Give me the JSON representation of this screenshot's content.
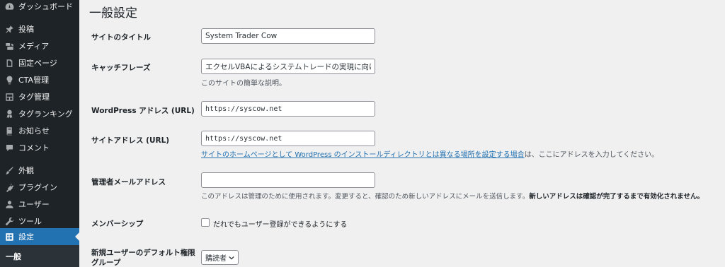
{
  "sidebar": {
    "items": [
      {
        "label": "ダッシュボード",
        "icon": "dashboard-icon"
      },
      {
        "label": "投稿",
        "icon": "pin-icon"
      },
      {
        "label": "メディア",
        "icon": "media-icon"
      },
      {
        "label": "固定ページ",
        "icon": "page-icon"
      },
      {
        "label": "CTA管理",
        "icon": "lightbulb-icon"
      },
      {
        "label": "タグ管理",
        "icon": "layout-icon"
      },
      {
        "label": "タグランキング",
        "icon": "award-icon"
      },
      {
        "label": "お知らせ",
        "icon": "book-icon"
      },
      {
        "label": "コメント",
        "icon": "comment-icon"
      },
      {
        "label": "外観",
        "icon": "brush-icon"
      },
      {
        "label": "プラグイン",
        "icon": "plugin-icon"
      },
      {
        "label": "ユーザー",
        "icon": "user-icon"
      },
      {
        "label": "ツール",
        "icon": "wrench-icon"
      },
      {
        "label": "設定",
        "icon": "settings-icon"
      }
    ],
    "submenu_active": "一般",
    "accent_color": "#2271b1"
  },
  "main": {
    "title": "一般設定",
    "fields": {
      "site_title": {
        "label": "サイトのタイトル",
        "value": "System Trader Cow"
      },
      "tagline": {
        "label": "キャッチフレーズ",
        "value": "エクセルVBAによるシステムトレードの実現に向けて",
        "description": "このサイトの簡単な説明。"
      },
      "wp_address": {
        "label": "WordPress アドレス (URL)",
        "value": "https://syscow.net"
      },
      "site_address": {
        "label": "サイトアドレス (URL)",
        "value": "https://syscow.net",
        "description_link": "サイトのホームページとして WordPress のインストールディレクトリとは異なる場所を設定する場合",
        "description_rest": "は、ここにアドレスを入力してください。"
      },
      "admin_email": {
        "label": "管理者メールアドレス",
        "value": "",
        "description": "このアドレスは管理のために使用されます。変更すると、確認のため新しいアドレスにメールを送信します。",
        "description_bold": "新しいアドレスは確認が完了するまで有効化されません。"
      },
      "membership": {
        "label": "メンバーシップ",
        "checkbox_label": "だれでもユーザー登録ができるようにする",
        "checked": false
      },
      "default_role": {
        "label_line1": "新規ユーザーのデフォルト権限",
        "label_line2": "グループ",
        "value": "購読者"
      }
    }
  }
}
